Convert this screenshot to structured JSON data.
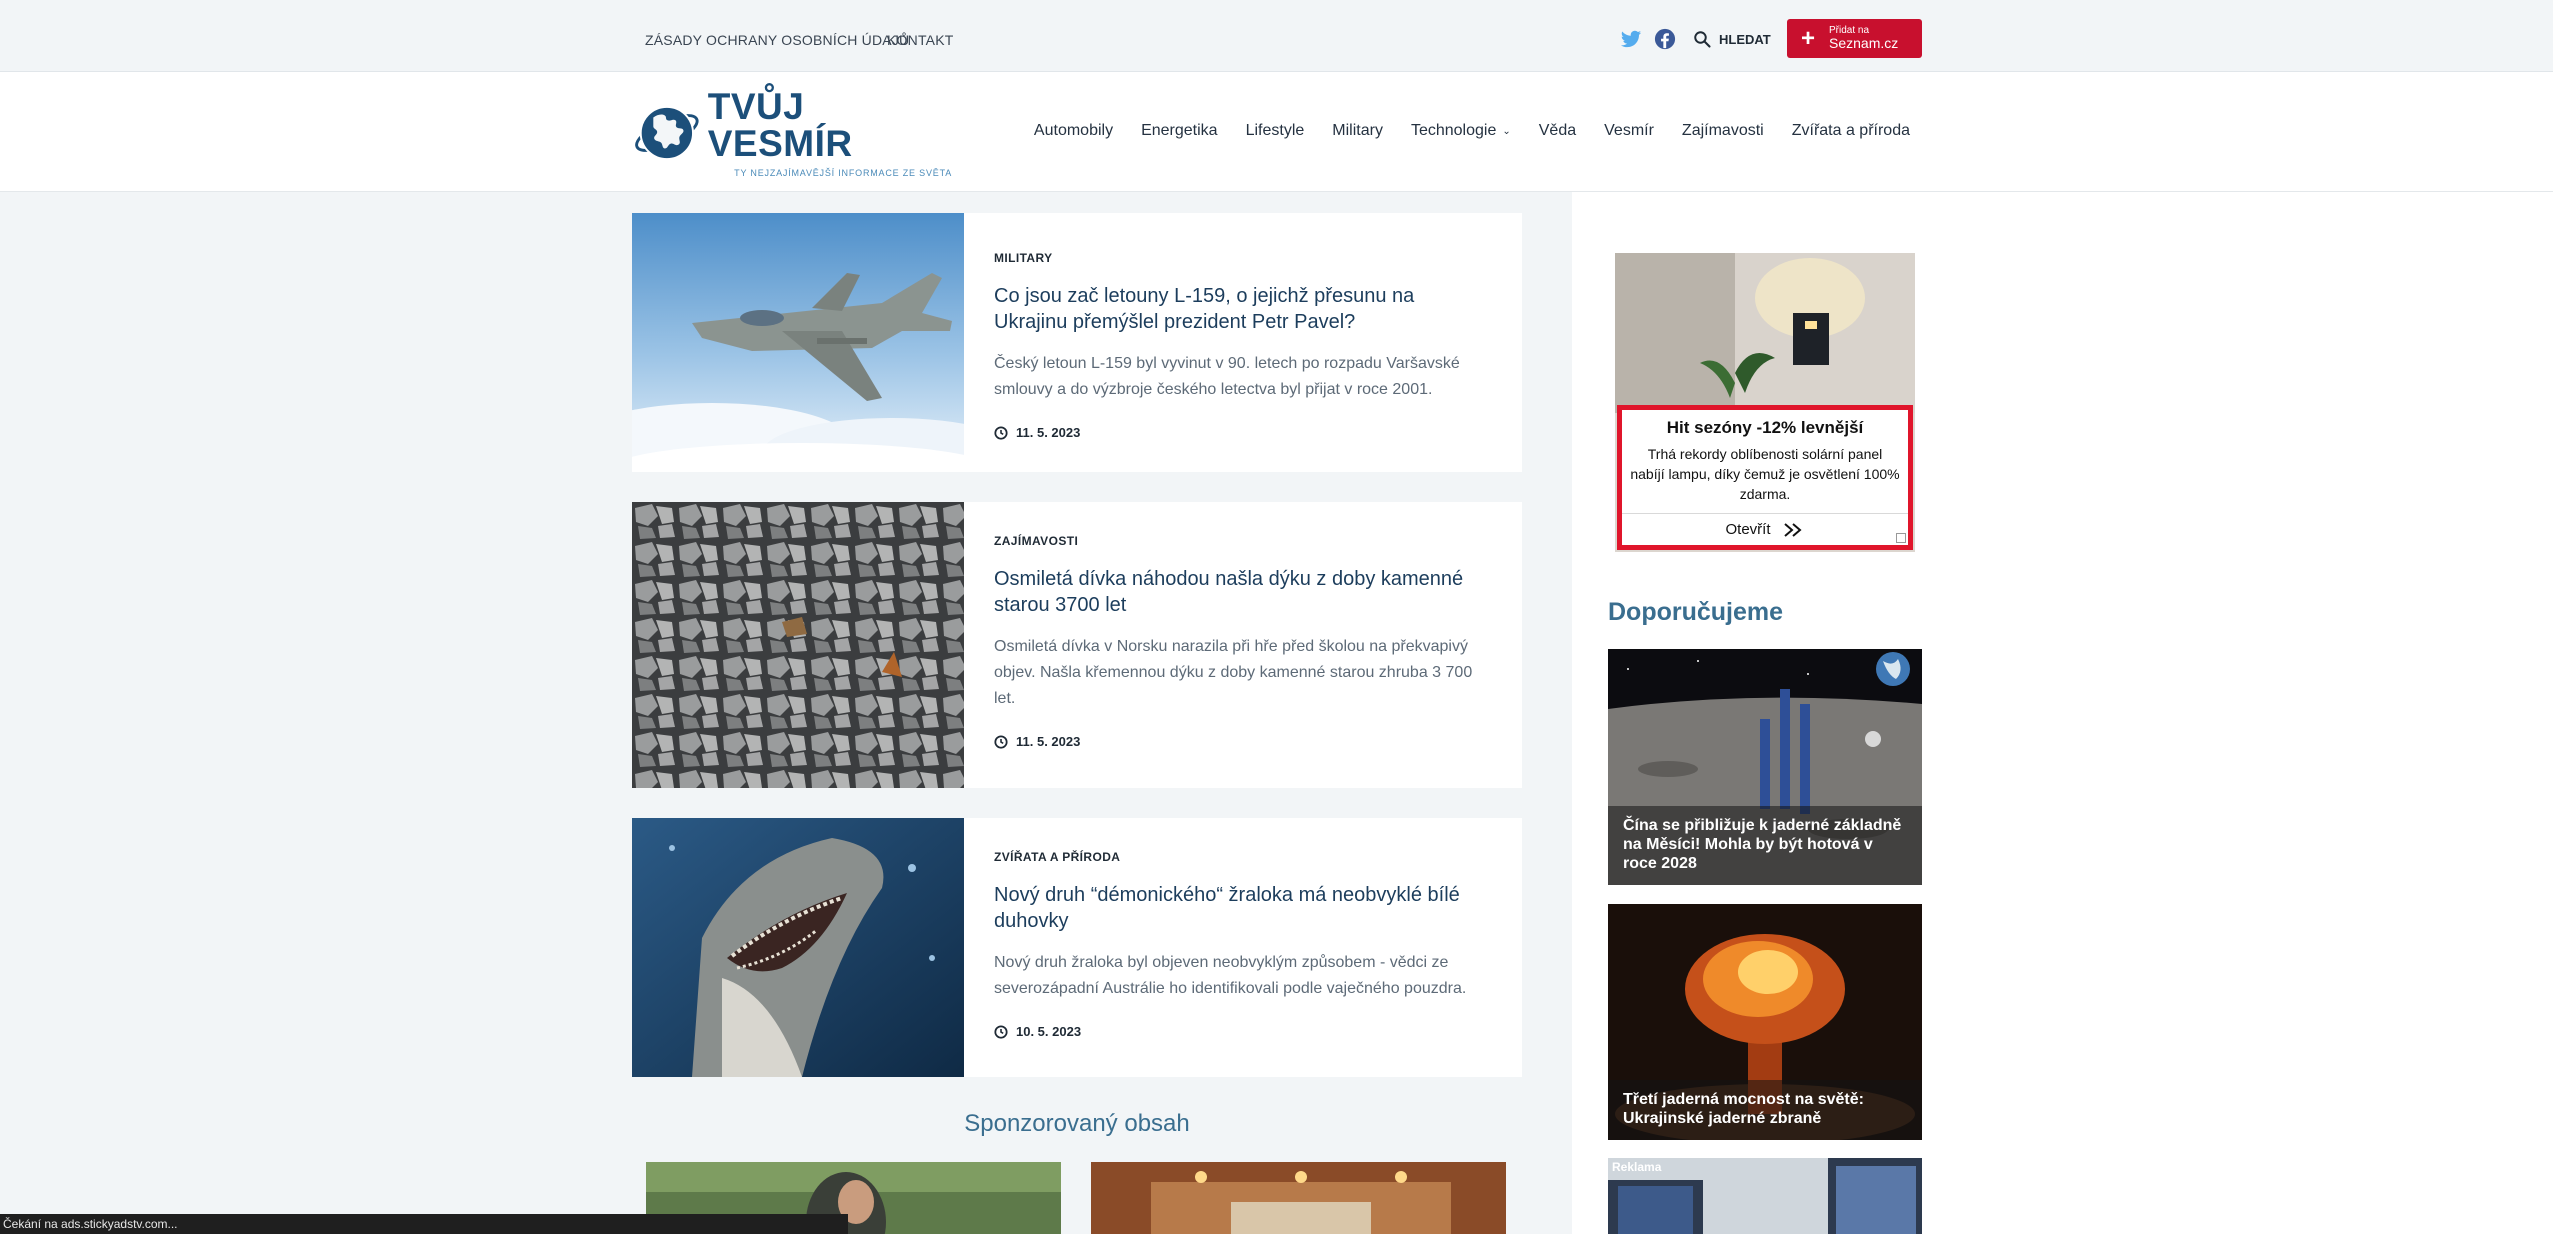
{
  "topbar": {
    "privacy": "ZÁSADY OCHRANY OSOBNÍCH ÚDAJŮ",
    "contact": "KONTAKT",
    "search": "HLEDAT",
    "seznam_line1": "Přidat na",
    "seznam_line2": "Seznam.cz",
    "seznam_plus": "+"
  },
  "logo": {
    "name": "TVŮJ VESMÍR",
    "tagline": "TY NEJZAJÍMAVĚJŠÍ INFORMACE ZE SVĚTA"
  },
  "nav": {
    "items": [
      "Automobily",
      "Energetika",
      "Lifestyle",
      "Military",
      "Technologie",
      "Věda",
      "Vesmír",
      "Zajímavosti",
      "Zvířata a příroda"
    ],
    "chevron": "⌄"
  },
  "articles": [
    {
      "category": "MILITARY",
      "title": "Co jsou zač letouny L-159, o jejichž přesunu na Ukrajinu přemýšlel prezident Petr Pavel?",
      "excerpt": "Český letoun L-159 byl vyvinut v 90. letech po rozpadu Varšavské smlouvy a do výzbroje českého letectva byl přijat v roce 2001.",
      "date": "11. 5. 2023"
    },
    {
      "category": "ZAJÍMAVOSTI",
      "title": "Osmiletá dívka náhodou našla dýku z doby kamenné starou 3700 let",
      "excerpt": "Osmiletá dívka v Norsku narazila při hře před školou na překvapivý objev. Našla křemennou dýku z doby kamenné starou zhruba 3 700 let.",
      "date": "11. 5. 2023"
    },
    {
      "category": "ZVÍŘATA A PŘÍRODA",
      "title": "Nový druh “démonického“ žraloka má neobvyklé bílé duhovky",
      "excerpt": "Nový druh žraloka byl objeven neobvyklým způsobem - vědci ze severozápadní Austrálie ho identifikovali podle vaječného pouzdra.",
      "date": "10. 5. 2023"
    }
  ],
  "sponsored": {
    "heading": "Sponzorovaný obsah"
  },
  "ad": {
    "headline": "Hit sezóny -12% levnější",
    "text": "Trhá rekordy oblíbenosti solární panel nabíjí lampu, díky čemuž je osvětlení 100% zdarma.",
    "button": "Otevřít"
  },
  "recommended": {
    "heading": "Doporučujeme",
    "items": [
      "Čína se přibližuje k jaderné základně na Měsíci! Mohla by být hotová v roce 2028",
      "Třetí jaderná mocnost na světě: Ukrajinské jaderné zbraně"
    ],
    "ad_label": "Reklama"
  },
  "status": "Čekání na ads.stickyadstv.com..."
}
